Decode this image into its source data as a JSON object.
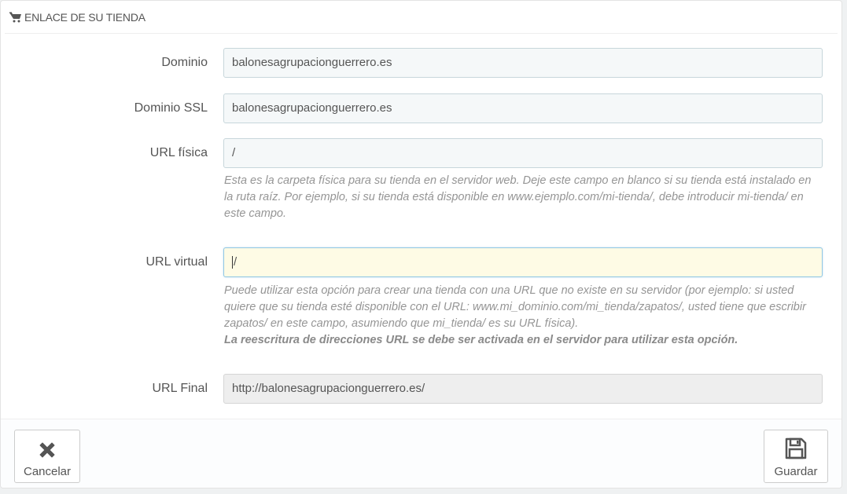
{
  "header": {
    "title": "ENLACE DE SU TIENDA",
    "icon": "cart-icon"
  },
  "fields": {
    "domain": {
      "label": "Dominio",
      "value": "balonesagrupacionguerrero.es"
    },
    "domain_ssl": {
      "label": "Dominio SSL",
      "value": "balonesagrupacionguerrero.es"
    },
    "physical_uri": {
      "label": "URL física",
      "value": "/",
      "help": "Esta es la carpeta física para su tienda en el servidor web. Deje este campo en blanco si su tienda está instalado en la ruta raíz. Por ejemplo, si su tienda está disponible en www.ejemplo.com/mi-tienda/, debe introducir mi-tienda/ en este campo."
    },
    "virtual_uri": {
      "label": "URL virtual",
      "value": "/",
      "help": "Puede utilizar esta opción para crear una tienda con una URL que no existe en su servidor (por ejemplo: si usted quiere que su tienda esté disponible con el URL: www.mi_dominio.com/mi_tienda/zapatos/, usted tiene que escribir zapatos/ en este campo, asumiendo que mi_tienda/ es su URL física).",
      "help_bold": "La reescritura de direcciones URL se debe ser activada en el servidor para utilizar esta opción."
    },
    "final_url": {
      "label": "URL Final",
      "value": "http://balonesagrupacionguerrero.es/"
    }
  },
  "footer": {
    "cancel_label": "Cancelar",
    "cancel_icon": "close-icon",
    "save_label": "Guardar",
    "save_icon": "floppy-disk-icon"
  },
  "colors": {
    "input_bg": "#f5f8f9",
    "focused_bg": "#fefbe5",
    "readonly_bg": "#eeeeee"
  }
}
